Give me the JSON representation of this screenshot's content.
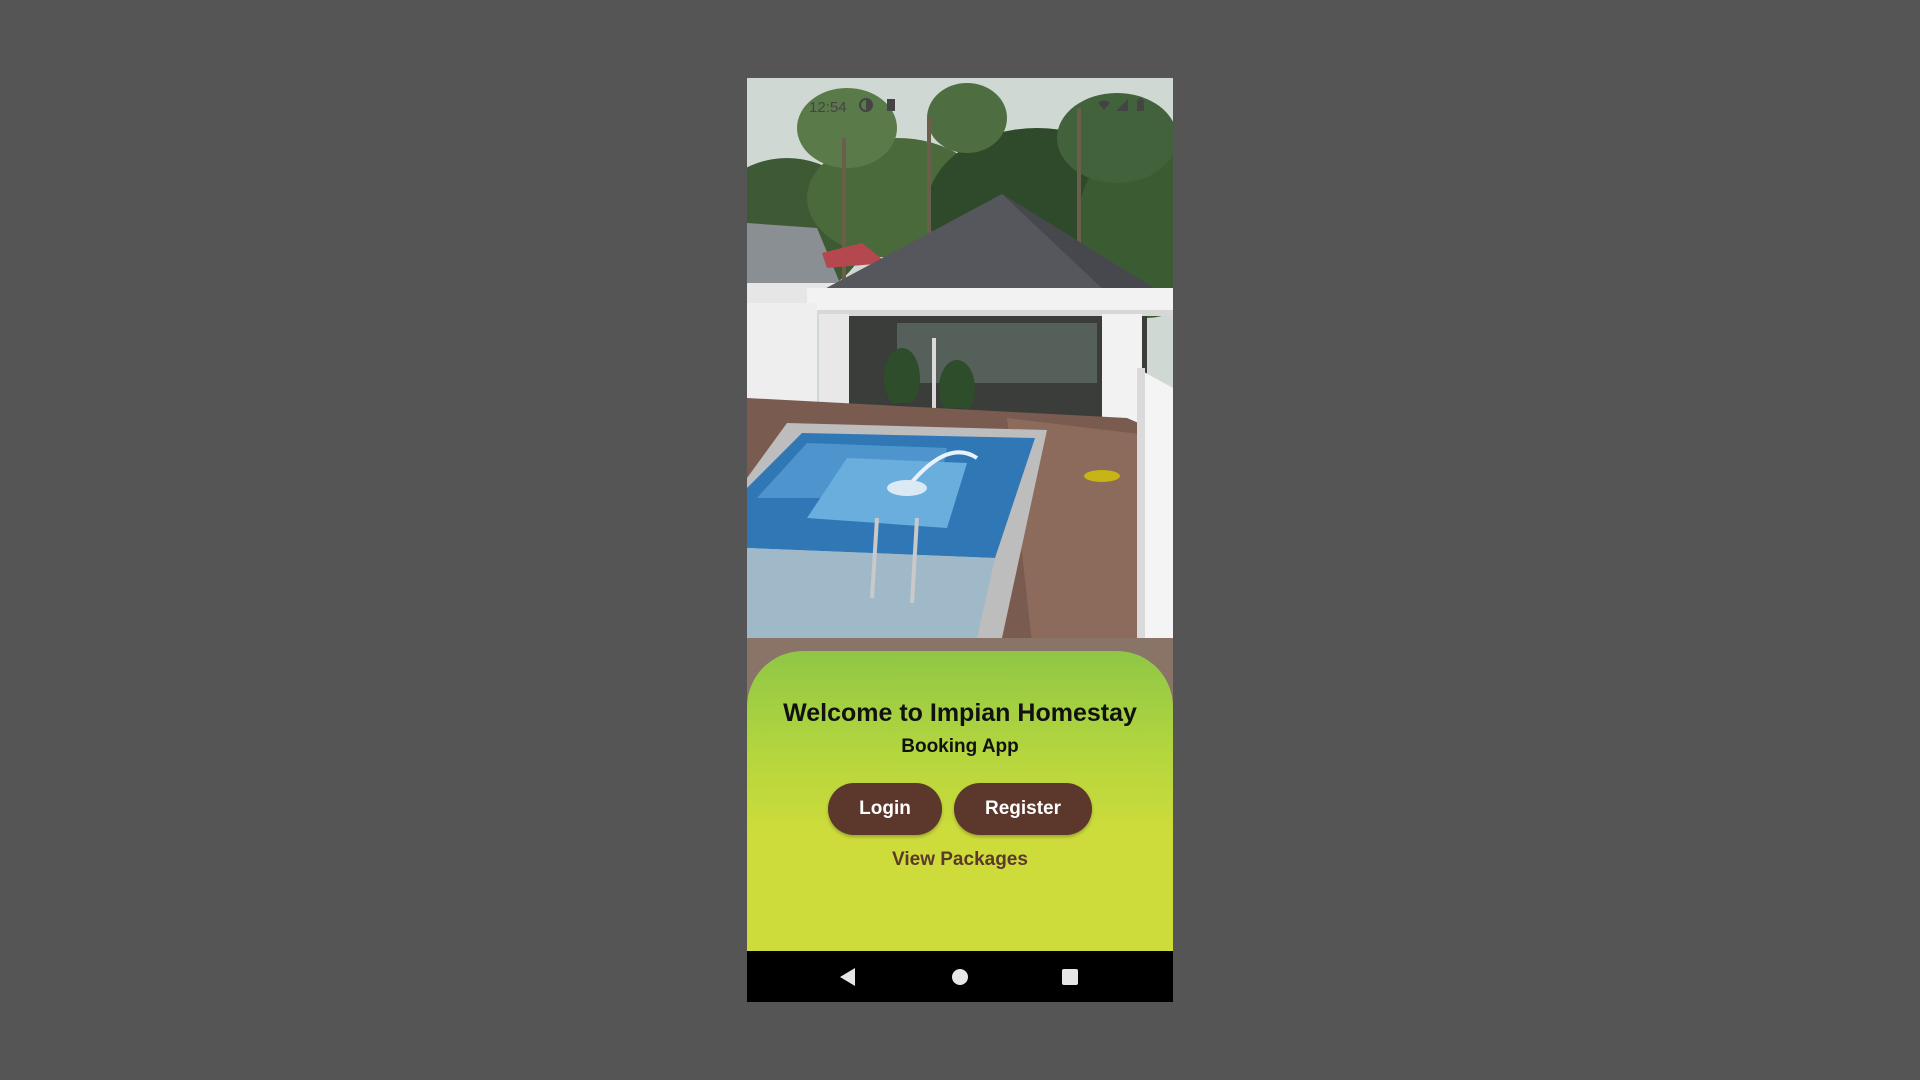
{
  "status_bar": {
    "time": "12:54",
    "icons": [
      "data-saver-icon",
      "sd-card-icon",
      "wifi-icon",
      "signal-icon",
      "battery-icon"
    ]
  },
  "hero": {
    "image_subject": "homestay villa with swimming pool and palm trees"
  },
  "card": {
    "title": "Welcome to Impian Homestay",
    "subtitle": "Booking App",
    "login_label": "Login",
    "register_label": "Register",
    "packages_link": "View Packages"
  },
  "colors": {
    "card_top": "#8fc746",
    "card_bottom": "#cddc3a",
    "button_bg": "#5b372c",
    "link_color": "#5b3a2b",
    "desktop_bg": "#555555"
  },
  "nav_bar": {
    "icons": [
      "back-icon",
      "home-icon",
      "recents-icon"
    ]
  }
}
